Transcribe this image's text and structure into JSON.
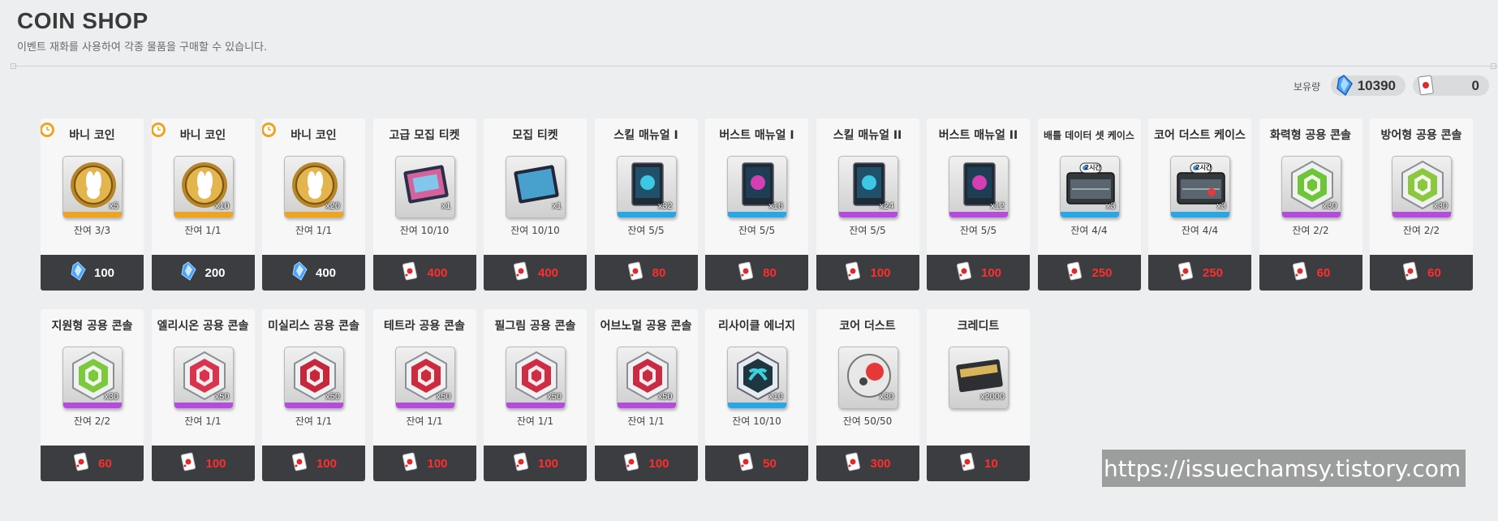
{
  "header": {
    "title": "COIN SHOP",
    "subtitle": "이벤트 재화를 사용하여 각종 물품을 구매할 수 있습니다."
  },
  "balance": {
    "label": "보유량",
    "gem_amount": "10390",
    "ticket_amount": "0"
  },
  "colors": {
    "price_red": "#ff2e2e",
    "price_bar": "#3b3d40",
    "gold": "#f0a31c",
    "blue": "#27a7e8",
    "purple": "#b64be0"
  },
  "items": [
    {
      "name": "바니 코인",
      "qty": "x5",
      "remain": "잔여 3/3",
      "price": "100",
      "currency": "gem",
      "rarity": "gold",
      "icon": "bunny-coin-icon",
      "timed": true
    },
    {
      "name": "바니 코인",
      "qty": "x10",
      "remain": "잔여 1/1",
      "price": "200",
      "currency": "gem",
      "rarity": "gold",
      "icon": "bunny-coin-icon",
      "timed": true
    },
    {
      "name": "바니 코인",
      "qty": "x20",
      "remain": "잔여 1/1",
      "price": "400",
      "currency": "gem",
      "rarity": "gold",
      "icon": "bunny-coin-icon",
      "timed": true
    },
    {
      "name": "고급 모집 티켓",
      "qty": "x1",
      "remain": "잔여 10/10",
      "price": "400",
      "currency": "ticket",
      "rarity": "none",
      "icon": "premium-recruit-ticket-icon",
      "timed": false
    },
    {
      "name": "모집 티켓",
      "qty": "x1",
      "remain": "잔여 10/10",
      "price": "400",
      "currency": "ticket",
      "rarity": "none",
      "icon": "recruit-ticket-icon",
      "timed": false
    },
    {
      "name": "스킬 매뉴얼 I",
      "qty": "x32",
      "remain": "잔여 5/5",
      "price": "80",
      "currency": "ticket",
      "rarity": "blue",
      "icon": "skill-manual-icon",
      "timed": false
    },
    {
      "name": "버스트 매뉴얼 I",
      "qty": "x16",
      "remain": "잔여 5/5",
      "price": "80",
      "currency": "ticket",
      "rarity": "blue",
      "icon": "burst-manual-icon",
      "timed": false
    },
    {
      "name": "스킬 매뉴얼 II",
      "qty": "x24",
      "remain": "잔여 5/5",
      "price": "100",
      "currency": "ticket",
      "rarity": "purple",
      "icon": "skill-manual-icon",
      "timed": false
    },
    {
      "name": "버스트 매뉴얼 II",
      "qty": "x12",
      "remain": "잔여 5/5",
      "price": "100",
      "currency": "ticket",
      "rarity": "purple",
      "icon": "burst-manual-icon",
      "timed": false
    },
    {
      "name": "배틀 데이터 셋 케이스",
      "qty": "x3",
      "remain": "잔여 4/4",
      "price": "250",
      "currency": "ticket",
      "rarity": "blue",
      "icon": "battle-data-case-icon",
      "timed": false,
      "small": true,
      "tag": "2시간"
    },
    {
      "name": "코어 더스트 케이스",
      "qty": "x3",
      "remain": "잔여 4/4",
      "price": "250",
      "currency": "ticket",
      "rarity": "blue",
      "icon": "core-dust-case-icon",
      "timed": false,
      "tag": "2시간"
    },
    {
      "name": "화력형 공용 콘솔",
      "qty": "x30",
      "remain": "잔여 2/2",
      "price": "60",
      "currency": "ticket",
      "rarity": "purple",
      "icon": "firepower-console-icon",
      "timed": false
    },
    {
      "name": "방어형 공용 콘솔",
      "qty": "x30",
      "remain": "잔여 2/2",
      "price": "60",
      "currency": "ticket",
      "rarity": "purple",
      "icon": "defender-console-icon",
      "timed": false
    },
    {
      "name": "지원형 공용 콘솔",
      "qty": "x30",
      "remain": "잔여 2/2",
      "price": "60",
      "currency": "ticket",
      "rarity": "purple",
      "icon": "supporter-console-icon",
      "timed": false
    },
    {
      "name": "엘리시온 공용 콘솔",
      "qty": "x50",
      "remain": "잔여 1/1",
      "price": "100",
      "currency": "ticket",
      "rarity": "purple",
      "icon": "elysion-console-icon",
      "timed": false
    },
    {
      "name": "미실리스 공용 콘솔",
      "qty": "x50",
      "remain": "잔여 1/1",
      "price": "100",
      "currency": "ticket",
      "rarity": "purple",
      "icon": "missilis-console-icon",
      "timed": false
    },
    {
      "name": "테트라 공용 콘솔",
      "qty": "x50",
      "remain": "잔여 1/1",
      "price": "100",
      "currency": "ticket",
      "rarity": "purple",
      "icon": "tetra-console-icon",
      "timed": false
    },
    {
      "name": "필그림 공용 콘솔",
      "qty": "x50",
      "remain": "잔여 1/1",
      "price": "100",
      "currency": "ticket",
      "rarity": "purple",
      "icon": "pilgrim-console-icon",
      "timed": false
    },
    {
      "name": "어브노멀 공용 콘솔",
      "qty": "x50",
      "remain": "잔여 1/1",
      "price": "100",
      "currency": "ticket",
      "rarity": "purple",
      "icon": "abnormal-console-icon",
      "timed": false
    },
    {
      "name": "리사이클 에너지",
      "qty": "x10",
      "remain": "잔여 10/10",
      "price": "50",
      "currency": "ticket",
      "rarity": "blue",
      "icon": "recycle-energy-icon",
      "timed": false
    },
    {
      "name": "코어 더스트",
      "qty": "x30",
      "remain": "잔여 50/50",
      "price": "300",
      "currency": "ticket",
      "rarity": "none",
      "icon": "core-dust-icon",
      "timed": false
    },
    {
      "name": "크레디트",
      "qty": "x2000",
      "remain": "",
      "price": "10",
      "currency": "ticket",
      "rarity": "none",
      "icon": "credit-card-icon",
      "timed": false
    }
  ],
  "watermark": "https://issuechamsy.tistory.com"
}
